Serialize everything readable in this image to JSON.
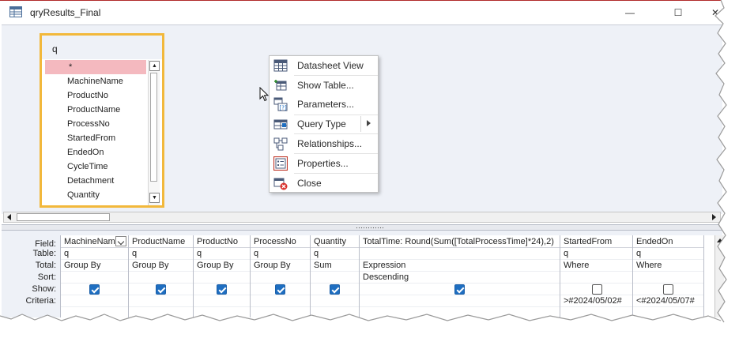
{
  "window": {
    "title": "qryResults_Final",
    "minimize_glyph": "—",
    "maximize_glyph": "☐",
    "close_glyph": "✕"
  },
  "table_box": {
    "name": "q",
    "fields": [
      "*",
      "MachineName",
      "ProductNo",
      "ProductName",
      "ProcessNo",
      "StartedFrom",
      "EndedOn",
      "CycleTime",
      "Detachment",
      "Quantity"
    ]
  },
  "context_menu": {
    "items": [
      {
        "label": "Datasheet View",
        "icon": "datasheet-icon"
      },
      {
        "label": "Show Table...",
        "icon": "show-table-icon"
      },
      {
        "label": "Parameters...",
        "icon": "parameters-icon"
      },
      {
        "label": "Query Type",
        "icon": "query-type-icon",
        "submenu": true
      },
      {
        "label": "Relationships...",
        "icon": "relationships-icon"
      },
      {
        "label": "Properties...",
        "icon": "properties-icon"
      },
      {
        "label": "Close",
        "icon": "close-icon"
      }
    ]
  },
  "grid": {
    "row_labels": [
      "Field:",
      "Table:",
      "Total:",
      "Sort:",
      "Show:",
      "Criteria:"
    ],
    "columns": [
      {
        "field": "MachineNam",
        "table": "q",
        "total": "Group By",
        "sort": "",
        "show": true,
        "criteria": ""
      },
      {
        "field": "ProductName",
        "table": "q",
        "total": "Group By",
        "sort": "",
        "show": true,
        "criteria": ""
      },
      {
        "field": "ProductNo",
        "table": "q",
        "total": "Group By",
        "sort": "",
        "show": true,
        "criteria": ""
      },
      {
        "field": "ProcessNo",
        "table": "q",
        "total": "Group By",
        "sort": "",
        "show": true,
        "criteria": ""
      },
      {
        "field": "Quantity",
        "table": "q",
        "total": "Sum",
        "sort": "",
        "show": true,
        "criteria": ""
      },
      {
        "field": "TotalTime: Round(Sum([TotalProcessTime]*24),2)",
        "table": "",
        "total": "Expression",
        "sort": "Descending",
        "show": true,
        "criteria": ""
      },
      {
        "field": "StartedFrom",
        "table": "q",
        "total": "Where",
        "sort": "",
        "show": false,
        "criteria": ">#2024/05/02#"
      },
      {
        "field": "EndedOn",
        "table": "q",
        "total": "Where",
        "sort": "",
        "show": false,
        "criteria": "<#2024/05/07#"
      }
    ]
  }
}
